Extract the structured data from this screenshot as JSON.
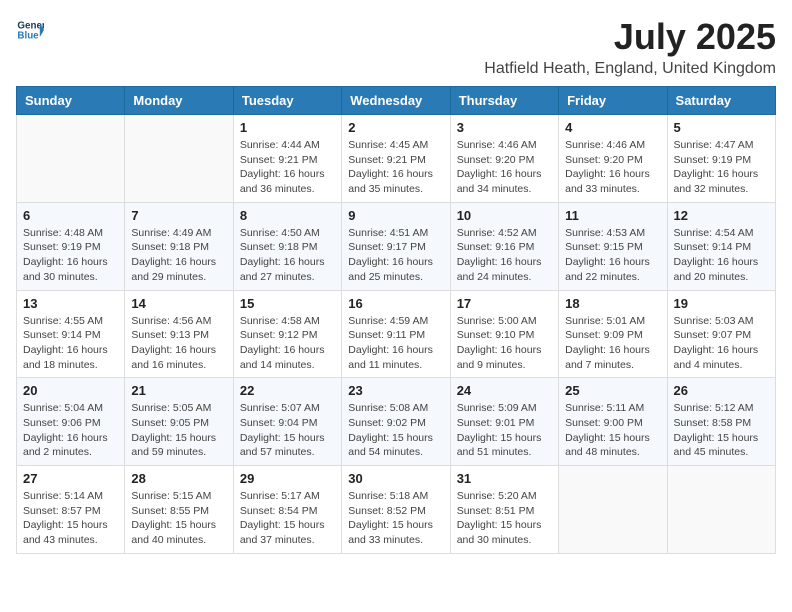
{
  "logo": {
    "line1": "General",
    "line2": "Blue"
  },
  "title": "July 2025",
  "location": "Hatfield Heath, England, United Kingdom",
  "days_of_week": [
    "Sunday",
    "Monday",
    "Tuesday",
    "Wednesday",
    "Thursday",
    "Friday",
    "Saturday"
  ],
  "weeks": [
    [
      {
        "day": "",
        "info": ""
      },
      {
        "day": "",
        "info": ""
      },
      {
        "day": "1",
        "info": "Sunrise: 4:44 AM\nSunset: 9:21 PM\nDaylight: 16 hours and 36 minutes."
      },
      {
        "day": "2",
        "info": "Sunrise: 4:45 AM\nSunset: 9:21 PM\nDaylight: 16 hours and 35 minutes."
      },
      {
        "day": "3",
        "info": "Sunrise: 4:46 AM\nSunset: 9:20 PM\nDaylight: 16 hours and 34 minutes."
      },
      {
        "day": "4",
        "info": "Sunrise: 4:46 AM\nSunset: 9:20 PM\nDaylight: 16 hours and 33 minutes."
      },
      {
        "day": "5",
        "info": "Sunrise: 4:47 AM\nSunset: 9:19 PM\nDaylight: 16 hours and 32 minutes."
      }
    ],
    [
      {
        "day": "6",
        "info": "Sunrise: 4:48 AM\nSunset: 9:19 PM\nDaylight: 16 hours and 30 minutes."
      },
      {
        "day": "7",
        "info": "Sunrise: 4:49 AM\nSunset: 9:18 PM\nDaylight: 16 hours and 29 minutes."
      },
      {
        "day": "8",
        "info": "Sunrise: 4:50 AM\nSunset: 9:18 PM\nDaylight: 16 hours and 27 minutes."
      },
      {
        "day": "9",
        "info": "Sunrise: 4:51 AM\nSunset: 9:17 PM\nDaylight: 16 hours and 25 minutes."
      },
      {
        "day": "10",
        "info": "Sunrise: 4:52 AM\nSunset: 9:16 PM\nDaylight: 16 hours and 24 minutes."
      },
      {
        "day": "11",
        "info": "Sunrise: 4:53 AM\nSunset: 9:15 PM\nDaylight: 16 hours and 22 minutes."
      },
      {
        "day": "12",
        "info": "Sunrise: 4:54 AM\nSunset: 9:14 PM\nDaylight: 16 hours and 20 minutes."
      }
    ],
    [
      {
        "day": "13",
        "info": "Sunrise: 4:55 AM\nSunset: 9:14 PM\nDaylight: 16 hours and 18 minutes."
      },
      {
        "day": "14",
        "info": "Sunrise: 4:56 AM\nSunset: 9:13 PM\nDaylight: 16 hours and 16 minutes."
      },
      {
        "day": "15",
        "info": "Sunrise: 4:58 AM\nSunset: 9:12 PM\nDaylight: 16 hours and 14 minutes."
      },
      {
        "day": "16",
        "info": "Sunrise: 4:59 AM\nSunset: 9:11 PM\nDaylight: 16 hours and 11 minutes."
      },
      {
        "day": "17",
        "info": "Sunrise: 5:00 AM\nSunset: 9:10 PM\nDaylight: 16 hours and 9 minutes."
      },
      {
        "day": "18",
        "info": "Sunrise: 5:01 AM\nSunset: 9:09 PM\nDaylight: 16 hours and 7 minutes."
      },
      {
        "day": "19",
        "info": "Sunrise: 5:03 AM\nSunset: 9:07 PM\nDaylight: 16 hours and 4 minutes."
      }
    ],
    [
      {
        "day": "20",
        "info": "Sunrise: 5:04 AM\nSunset: 9:06 PM\nDaylight: 16 hours and 2 minutes."
      },
      {
        "day": "21",
        "info": "Sunrise: 5:05 AM\nSunset: 9:05 PM\nDaylight: 15 hours and 59 minutes."
      },
      {
        "day": "22",
        "info": "Sunrise: 5:07 AM\nSunset: 9:04 PM\nDaylight: 15 hours and 57 minutes."
      },
      {
        "day": "23",
        "info": "Sunrise: 5:08 AM\nSunset: 9:02 PM\nDaylight: 15 hours and 54 minutes."
      },
      {
        "day": "24",
        "info": "Sunrise: 5:09 AM\nSunset: 9:01 PM\nDaylight: 15 hours and 51 minutes."
      },
      {
        "day": "25",
        "info": "Sunrise: 5:11 AM\nSunset: 9:00 PM\nDaylight: 15 hours and 48 minutes."
      },
      {
        "day": "26",
        "info": "Sunrise: 5:12 AM\nSunset: 8:58 PM\nDaylight: 15 hours and 45 minutes."
      }
    ],
    [
      {
        "day": "27",
        "info": "Sunrise: 5:14 AM\nSunset: 8:57 PM\nDaylight: 15 hours and 43 minutes."
      },
      {
        "day": "28",
        "info": "Sunrise: 5:15 AM\nSunset: 8:55 PM\nDaylight: 15 hours and 40 minutes."
      },
      {
        "day": "29",
        "info": "Sunrise: 5:17 AM\nSunset: 8:54 PM\nDaylight: 15 hours and 37 minutes."
      },
      {
        "day": "30",
        "info": "Sunrise: 5:18 AM\nSunset: 8:52 PM\nDaylight: 15 hours and 33 minutes."
      },
      {
        "day": "31",
        "info": "Sunrise: 5:20 AM\nSunset: 8:51 PM\nDaylight: 15 hours and 30 minutes."
      },
      {
        "day": "",
        "info": ""
      },
      {
        "day": "",
        "info": ""
      }
    ]
  ]
}
